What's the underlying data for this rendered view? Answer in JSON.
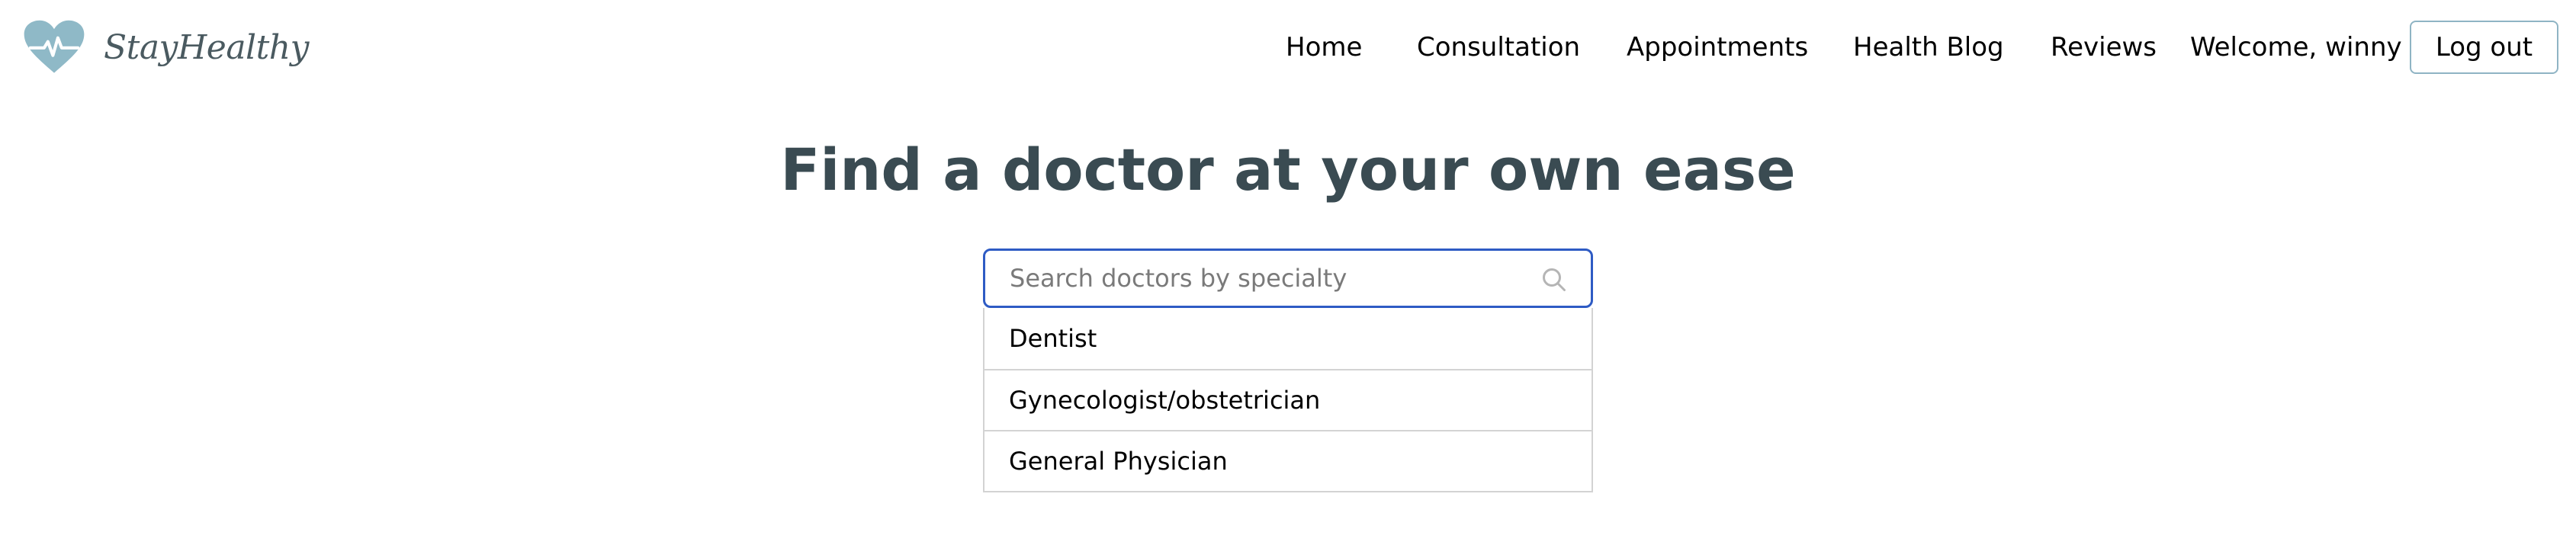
{
  "brand": {
    "name": "StayHealthy",
    "logo_color": "#8fb9c7"
  },
  "nav": {
    "links": [
      "Home",
      "Consultation",
      "Appointments",
      "Health Blog",
      "Reviews"
    ],
    "welcome": "Welcome, winny",
    "logout_label": "Log out"
  },
  "main": {
    "headline": "Find a doctor at your own ease",
    "search": {
      "placeholder": "Search doctors by specialty",
      "value": ""
    },
    "suggestions": [
      "Dentist",
      "Gynecologist/obstetrician",
      "General Physician"
    ]
  },
  "colors": {
    "accent_border": "#2e5bc4",
    "headline": "#3a4b52",
    "logout_border": "#8fb4c4"
  }
}
